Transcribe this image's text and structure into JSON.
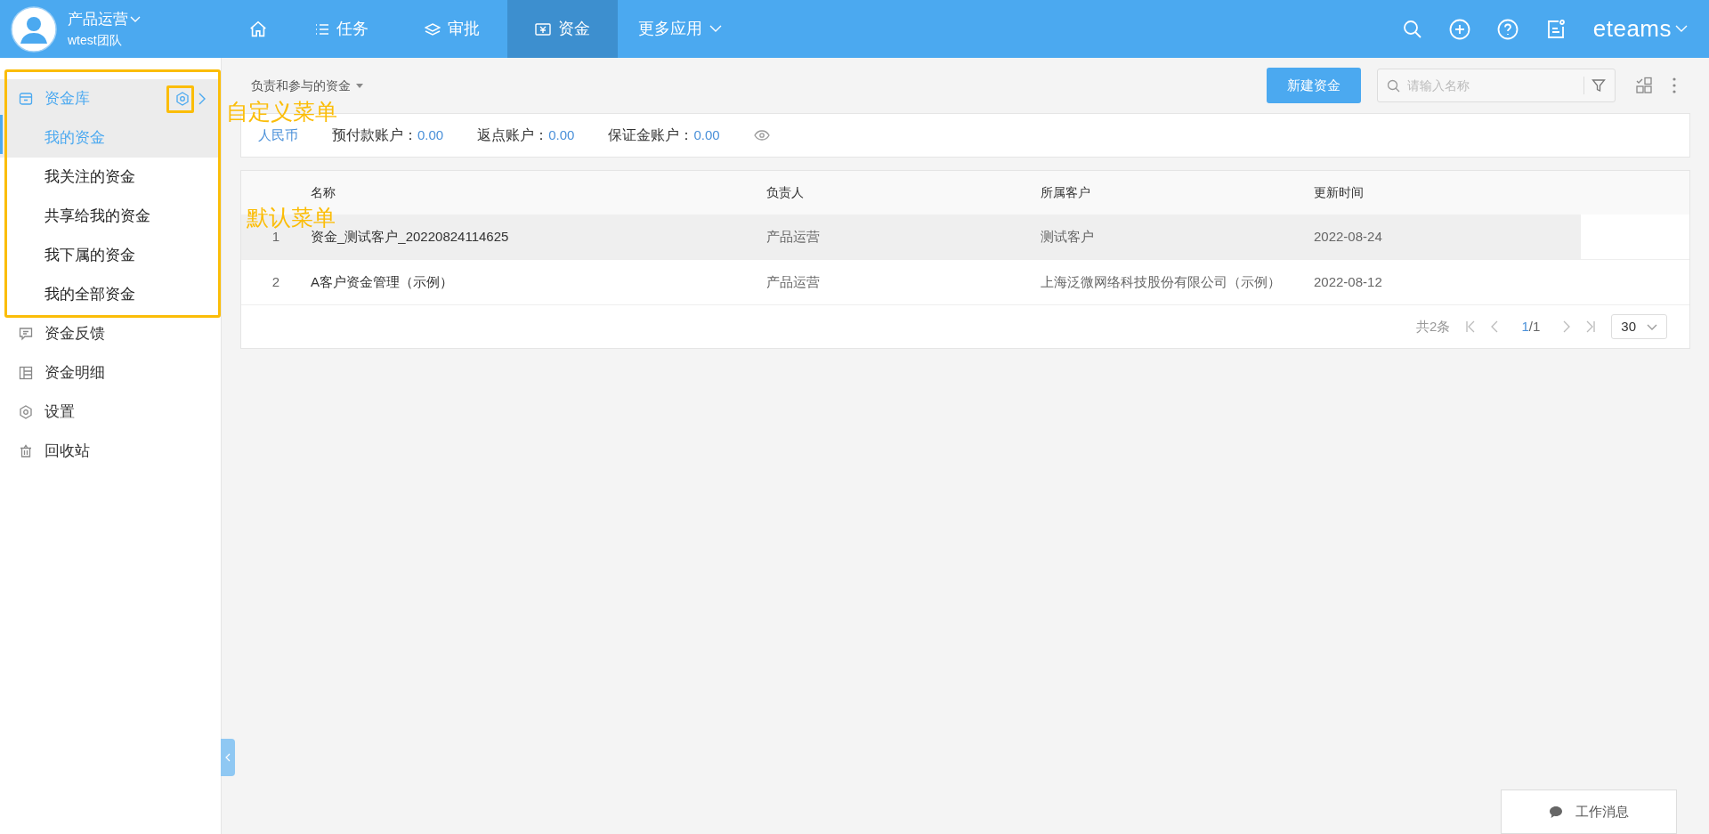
{
  "user": {
    "name": "产品运营",
    "team": "wtest团队"
  },
  "nav": [
    {
      "kind": "home",
      "selected": false
    },
    {
      "kind": "list",
      "label": "任务",
      "selected": false
    },
    {
      "kind": "layers",
      "label": "审批",
      "selected": false
    },
    {
      "kind": "money",
      "label": "资金",
      "selected": true
    },
    {
      "kind": "more",
      "label": "更多应用",
      "selected": false
    }
  ],
  "brand": "eteams",
  "sidebar": {
    "items": [
      {
        "kind": "box",
        "label": "资金库",
        "expanded": true,
        "children": [
          {
            "label": "我的资金",
            "selected": true
          },
          {
            "label": "我关注的资金",
            "selected": false
          },
          {
            "label": "共享给我的资金",
            "selected": false
          },
          {
            "label": "我下属的资金",
            "selected": false
          },
          {
            "label": "我的全部资金",
            "selected": false
          }
        ]
      },
      {
        "kind": "comment",
        "label": "资金反馈"
      },
      {
        "kind": "table",
        "label": "资金明细"
      },
      {
        "kind": "gear",
        "label": "设置"
      },
      {
        "kind": "trash",
        "label": "回收站"
      }
    ]
  },
  "annotations": [
    "自定义菜单",
    "默认菜单"
  ],
  "toolbar": {
    "filter": "负责和参与的资金",
    "new_button": "新建资金",
    "search": {
      "placeholder": "请输入名称"
    }
  },
  "accounts": {
    "currency": "人民币",
    "items": [
      {
        "label": "预付款账户：",
        "value": "0.00"
      },
      {
        "label": "返点账户：",
        "value": "0.00"
      },
      {
        "label": "保证金账户：",
        "value": "0.00"
      }
    ]
  },
  "table": {
    "columns": [
      "名称",
      "负责人",
      "所属客户",
      "更新时间"
    ],
    "rows": [
      {
        "index": "1",
        "cells": [
          "资金_测试客户_20220824114625",
          "产品运营",
          "测试客户",
          "2022-08-24"
        ],
        "hovered": true
      },
      {
        "index": "2",
        "cells": [
          "A客户资金管理（示例）",
          "产品运营",
          "上海泛微网络科技股份有限公司（示例）",
          "2022-08-12"
        ],
        "hovered": false
      }
    ]
  },
  "pagination": {
    "total": "共2条",
    "current": "1",
    "pages": "/1",
    "page_size": "30"
  },
  "work_messages": "工作消息"
}
